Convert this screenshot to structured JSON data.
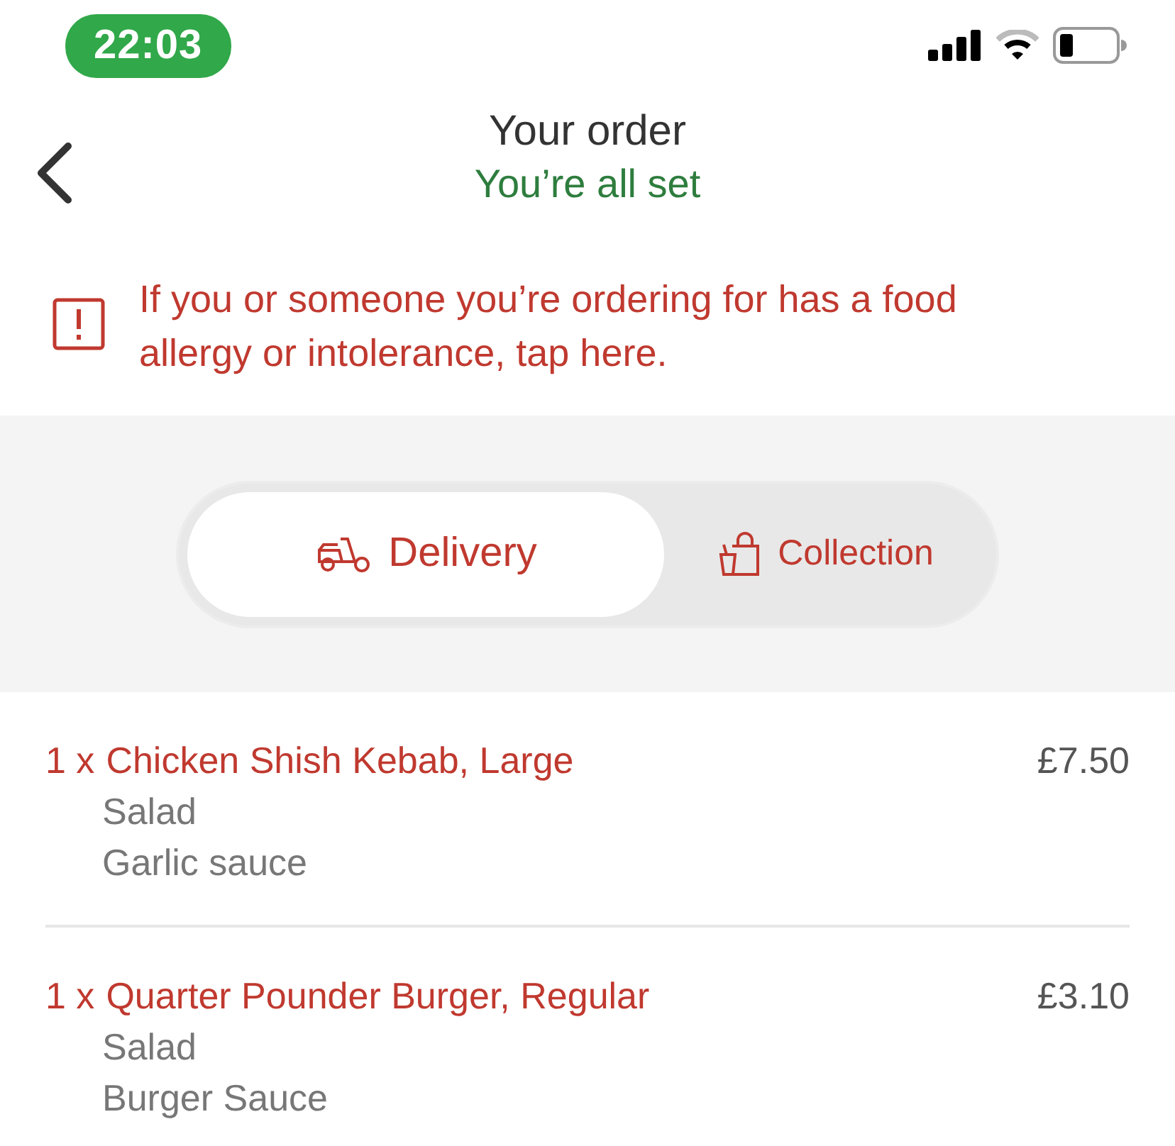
{
  "status_bar": {
    "time": "22:03"
  },
  "header": {
    "title": "Your order",
    "subtitle": "You’re all set"
  },
  "allergy_notice": {
    "text": "If you or someone you’re ordering for has a food allergy or intolerance, tap here."
  },
  "order_mode": [
    {
      "label": "Delivery",
      "kind": "delivery",
      "selected": true
    },
    {
      "label": "Collection",
      "kind": "collection",
      "selected": false
    }
  ],
  "items": [
    {
      "quantity": "1 x",
      "name": "Chicken Shish Kebab, Large",
      "price": "£7.50",
      "options": [
        "Salad",
        "Garlic sauce"
      ]
    },
    {
      "quantity": "1 x",
      "name": "Quarter Pounder Burger, Regular",
      "price": "£3.10",
      "options": [
        "Salad",
        "Burger Sauce"
      ]
    }
  ]
}
